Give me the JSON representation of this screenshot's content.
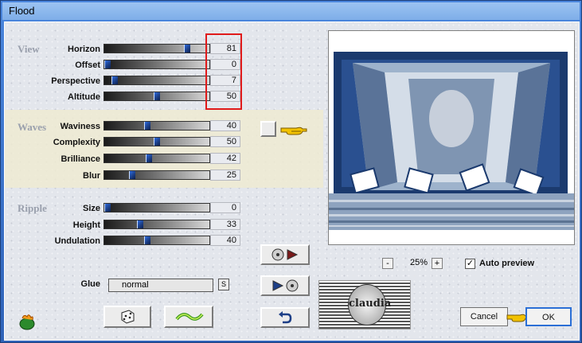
{
  "window": {
    "title": "Flood"
  },
  "sections": {
    "view": "View",
    "waves": "Waves",
    "ripple": "Ripple"
  },
  "params": {
    "view": [
      {
        "label": "Horizon",
        "value": "81",
        "fraction": 0.81
      },
      {
        "label": "Offset",
        "value": "0",
        "fraction": 0.0
      },
      {
        "label": "Perspective",
        "value": "7",
        "fraction": 0.07
      },
      {
        "label": "Altitude",
        "value": "50",
        "fraction": 0.5
      }
    ],
    "waves": [
      {
        "label": "Waviness",
        "value": "40",
        "fraction": 0.4
      },
      {
        "label": "Complexity",
        "value": "50",
        "fraction": 0.5
      },
      {
        "label": "Brilliance",
        "value": "42",
        "fraction": 0.42
      },
      {
        "label": "Blur",
        "value": "25",
        "fraction": 0.25
      }
    ],
    "ripple": [
      {
        "label": "Size",
        "value": "0",
        "fraction": 0.0
      },
      {
        "label": "Height",
        "value": "33",
        "fraction": 0.33
      },
      {
        "label": "Undulation",
        "value": "40",
        "fraction": 0.4
      }
    ]
  },
  "glue": {
    "label": "Glue",
    "value": "normal",
    "button": "S"
  },
  "zoom": {
    "minus": "-",
    "value": "25%",
    "plus": "+"
  },
  "auto_preview": {
    "label": "Auto preview",
    "checked": true,
    "mark": "✓"
  },
  "buttons": {
    "cancel": "Cancel",
    "ok": "OK"
  },
  "stamp": {
    "text": "claudia"
  },
  "icons": {
    "pointer_hand": "pointing-hand-icon",
    "dice": "dice-icon",
    "wave": "wave-icon",
    "undo": "undo-icon",
    "disc_play": "disc-play-icon",
    "play_disc": "play-disc-icon",
    "app_logo": "filter-logo-icon"
  },
  "colors": {
    "accent": "#2b6fd6",
    "highlight_frame": "#e01a1a",
    "pointer": "#f2c200"
  }
}
